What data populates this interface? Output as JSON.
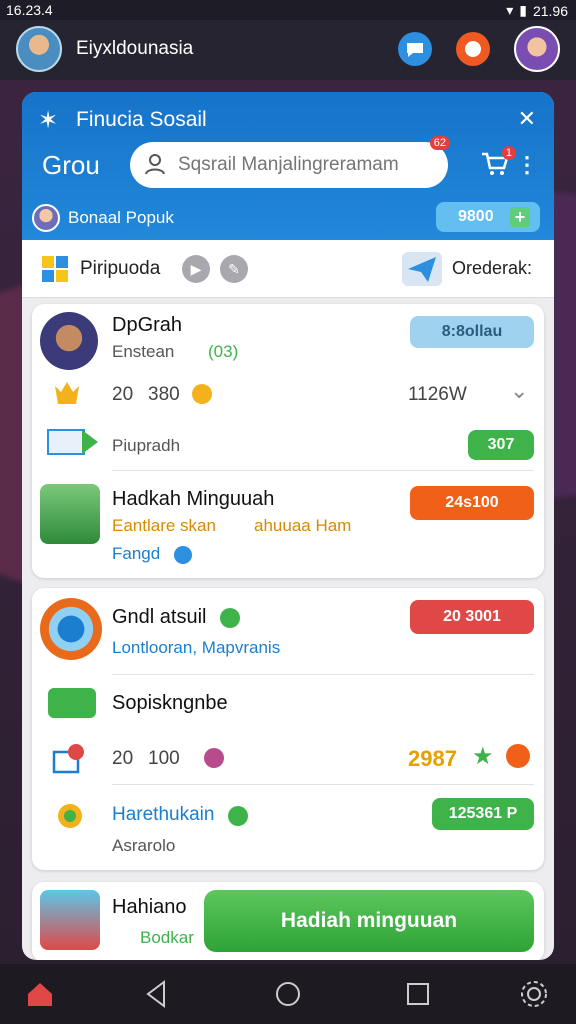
{
  "status": {
    "time": "16.23.4",
    "right_text": "21.96"
  },
  "topbar": {
    "title": "Eiyxldounasia"
  },
  "header": {
    "title": "Finucia Sosail",
    "group_label": "Grou",
    "search_placeholder": "Sqsrail Manjalingreramam",
    "search_badge": "62",
    "cart_badge": "1",
    "profile_name": "Bonaal Popuk",
    "points": "9800",
    "points_plus": "+"
  },
  "toolbar": {
    "label": "Piripuoda",
    "orders": "Orederak:"
  },
  "cards": [
    {
      "name": "DpGrah",
      "sub": "Enstean",
      "sub_code": "(03)",
      "pill": "8:8ollau",
      "stat1": "20",
      "stat2": "380",
      "stat3": "1126W",
      "row_label": "Piupradh",
      "row_pill": "307"
    },
    {
      "name": "Hadkah Minguuah",
      "sub": "Eantlare skan",
      "sub2": "ahuuaa Ham",
      "sub3": "Fangd",
      "pill": "24s100"
    },
    {
      "name": "Gndl atsuil",
      "sub": "Lontlooran, Mapvranis",
      "pill": "20 3001",
      "row_label": "Sopiskngnbe",
      "stat1": "20",
      "stat2": "100",
      "stat3": "2987",
      "row2_name": "Harethukain",
      "row2_sub": "Asrarolo",
      "row2_pill": "125361 P"
    },
    {
      "name": "Hahiano",
      "sub": "Bodkar",
      "button": "Hadiah minguuan"
    }
  ],
  "colors": {
    "header_blue": "#1b7ecf",
    "green": "#3db34a",
    "orange": "#f06018",
    "red": "#e04848",
    "light_blue": "#9fd2ef"
  }
}
